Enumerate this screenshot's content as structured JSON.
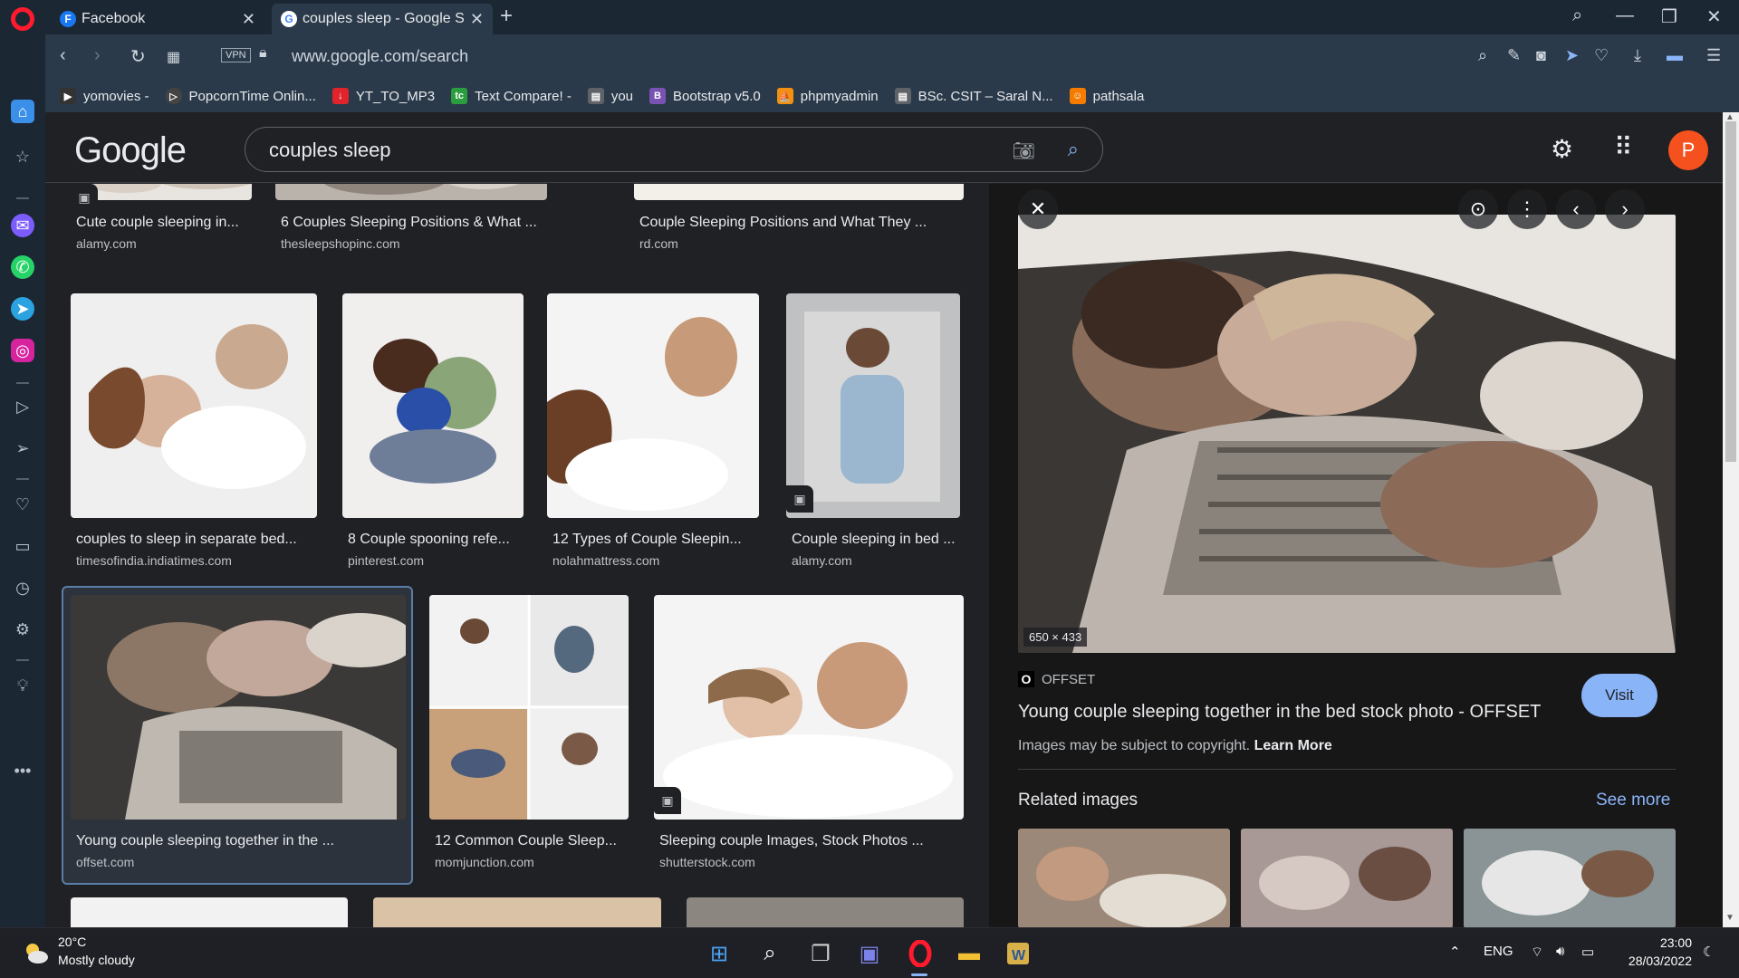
{
  "browser": {
    "tabs": [
      {
        "label": "Facebook",
        "favicon": "F"
      },
      {
        "label": "couples sleep - Google Sea",
        "favicon": "G"
      }
    ],
    "url": "www.google.com/search",
    "vpn_label": "VPN",
    "bookmarks": [
      {
        "label": "yomovies -",
        "icon_color": "#333333",
        "icon": "▶"
      },
      {
        "label": "PopcornTime Onlin...",
        "icon_color": "#444444",
        "icon": "▷"
      },
      {
        "label": "YT_TO_MP3",
        "icon_color": "#e0242b",
        "icon": "↓"
      },
      {
        "label": "Text Compare! -",
        "icon_color": "#2a9d3f",
        "icon": "tc"
      },
      {
        "label": "you",
        "icon_color": "#5f6368",
        "icon": "▤"
      },
      {
        "label": "Bootstrap v5.0",
        "icon_color": "#7952b3",
        "icon": "B"
      },
      {
        "label": "phpmyadmin",
        "icon_color": "#f29111",
        "icon": "⛵"
      },
      {
        "label": "BSc. CSIT – Saral N...",
        "icon_color": "#5f6368",
        "icon": "▤"
      },
      {
        "label": "pathsala",
        "icon_color": "#f57c00",
        "icon": "☺"
      }
    ]
  },
  "google": {
    "logo": "Google",
    "query": "couples sleep",
    "avatar_letter": "P"
  },
  "results": {
    "row0": [
      {
        "caption": "Cute couple sleeping in...",
        "source": "alamy.com"
      },
      {
        "caption": "6 Couples Sleeping Positions & What ...",
        "source": "thesleepshopinc.com"
      },
      {
        "caption": "Couple Sleeping Positions and What They ...",
        "source": "rd.com"
      }
    ],
    "row1": [
      {
        "caption": "couples to sleep in separate bed...",
        "source": "timesofindia.indiatimes.com"
      },
      {
        "caption": "8 Couple spooning refe...",
        "source": "pinterest.com"
      },
      {
        "caption": "12 Types of Couple Sleepin...",
        "source": "nolahmattress.com"
      },
      {
        "caption": "Couple sleeping in bed ...",
        "source": "alamy.com"
      }
    ],
    "row2": [
      {
        "caption": "Young couple sleeping together in the ...",
        "source": "offset.com"
      },
      {
        "caption": "12 Common Couple Sleep...",
        "source": "momjunction.com"
      },
      {
        "caption": "Sleeping couple Images, Stock Photos ...",
        "source": "shutterstock.com"
      }
    ]
  },
  "preview": {
    "dimensions": "650 × 433",
    "site_icon": "O",
    "site": "OFFSET",
    "title": "Young couple sleeping together in the bed stock photo - OFFSET",
    "copyright_text": "Images may be subject to copyright.",
    "learn_more": "Learn More",
    "visit_label": "Visit",
    "related_label": "Related images",
    "see_more_label": "See more"
  },
  "taskbar": {
    "temperature": "20°C",
    "weather": "Mostly cloudy",
    "language": "ENG",
    "time": "23:00",
    "date": "28/03/2022"
  }
}
